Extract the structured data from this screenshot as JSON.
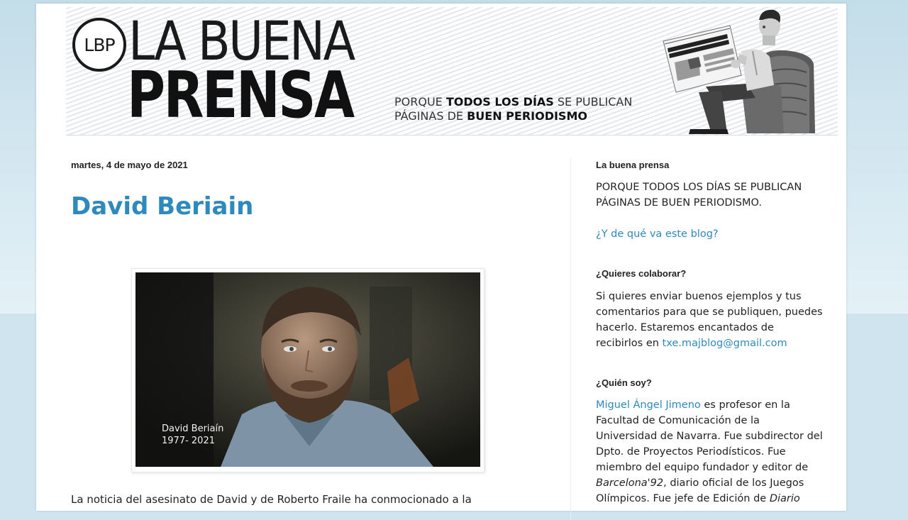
{
  "header": {
    "logo_text": "LBP",
    "title_line1": "LA BUENA",
    "title_line2": "PRENSA",
    "tagline": {
      "l1_a": "PORQUE ",
      "l1_b": "TODOS LOS DÍAS",
      "l1_c": " SE PUBLICAN",
      "l2_a": "PÁGINAS DE ",
      "l2_b": "BUEN PERIODISMO"
    },
    "newspaper_headline": "5 FLYERS BAIL OUT OVER PACIFIC — 2 SAVED"
  },
  "post": {
    "date": "martes, 4 de mayo de 2021",
    "title": "David Beriain",
    "photo_caption_name": "David Beriaín",
    "photo_caption_years": "1977- 2021",
    "body_start": "La noticia del asesinato de David y de Roberto Fraile ha conmocionado a la"
  },
  "sidebar": {
    "widget1": {
      "title": "La buena prensa",
      "text_l1": "PORQUE TODOS LOS DÍAS SE PUBLICAN",
      "text_l2": "PÁGINAS DE BUEN PERIODISMO.",
      "link": "¿Y de qué va este blog?"
    },
    "widget2": {
      "title": "¿Quieres colaborar?",
      "text": "Si quieres enviar buenos ejemplos y tus comentarios para que se publiquen, puedes hacerlo. Estaremos encantados de recibirlos en ",
      "email": "txe.majblog@gmail.com"
    },
    "widget3": {
      "title": "¿Quién soy?",
      "author_link": "Miguel Ángel Jimeno",
      "text_a": " es profesor en la Facultad de Comunicación de la Universidad de Navarra. Fue subdirector del Dpto. de Proyectos Periodísticos. Fue miembro del equipo fundador y editor de ",
      "italic_a": "Barcelona'92",
      "text_b": ", diario oficial de los Juegos Olímpicos. Fue jefe de Edición de ",
      "italic_b": "Diario"
    }
  },
  "colors": {
    "link": "#2e89bd",
    "page_background": "#cfe4ee",
    "text": "#222222"
  }
}
